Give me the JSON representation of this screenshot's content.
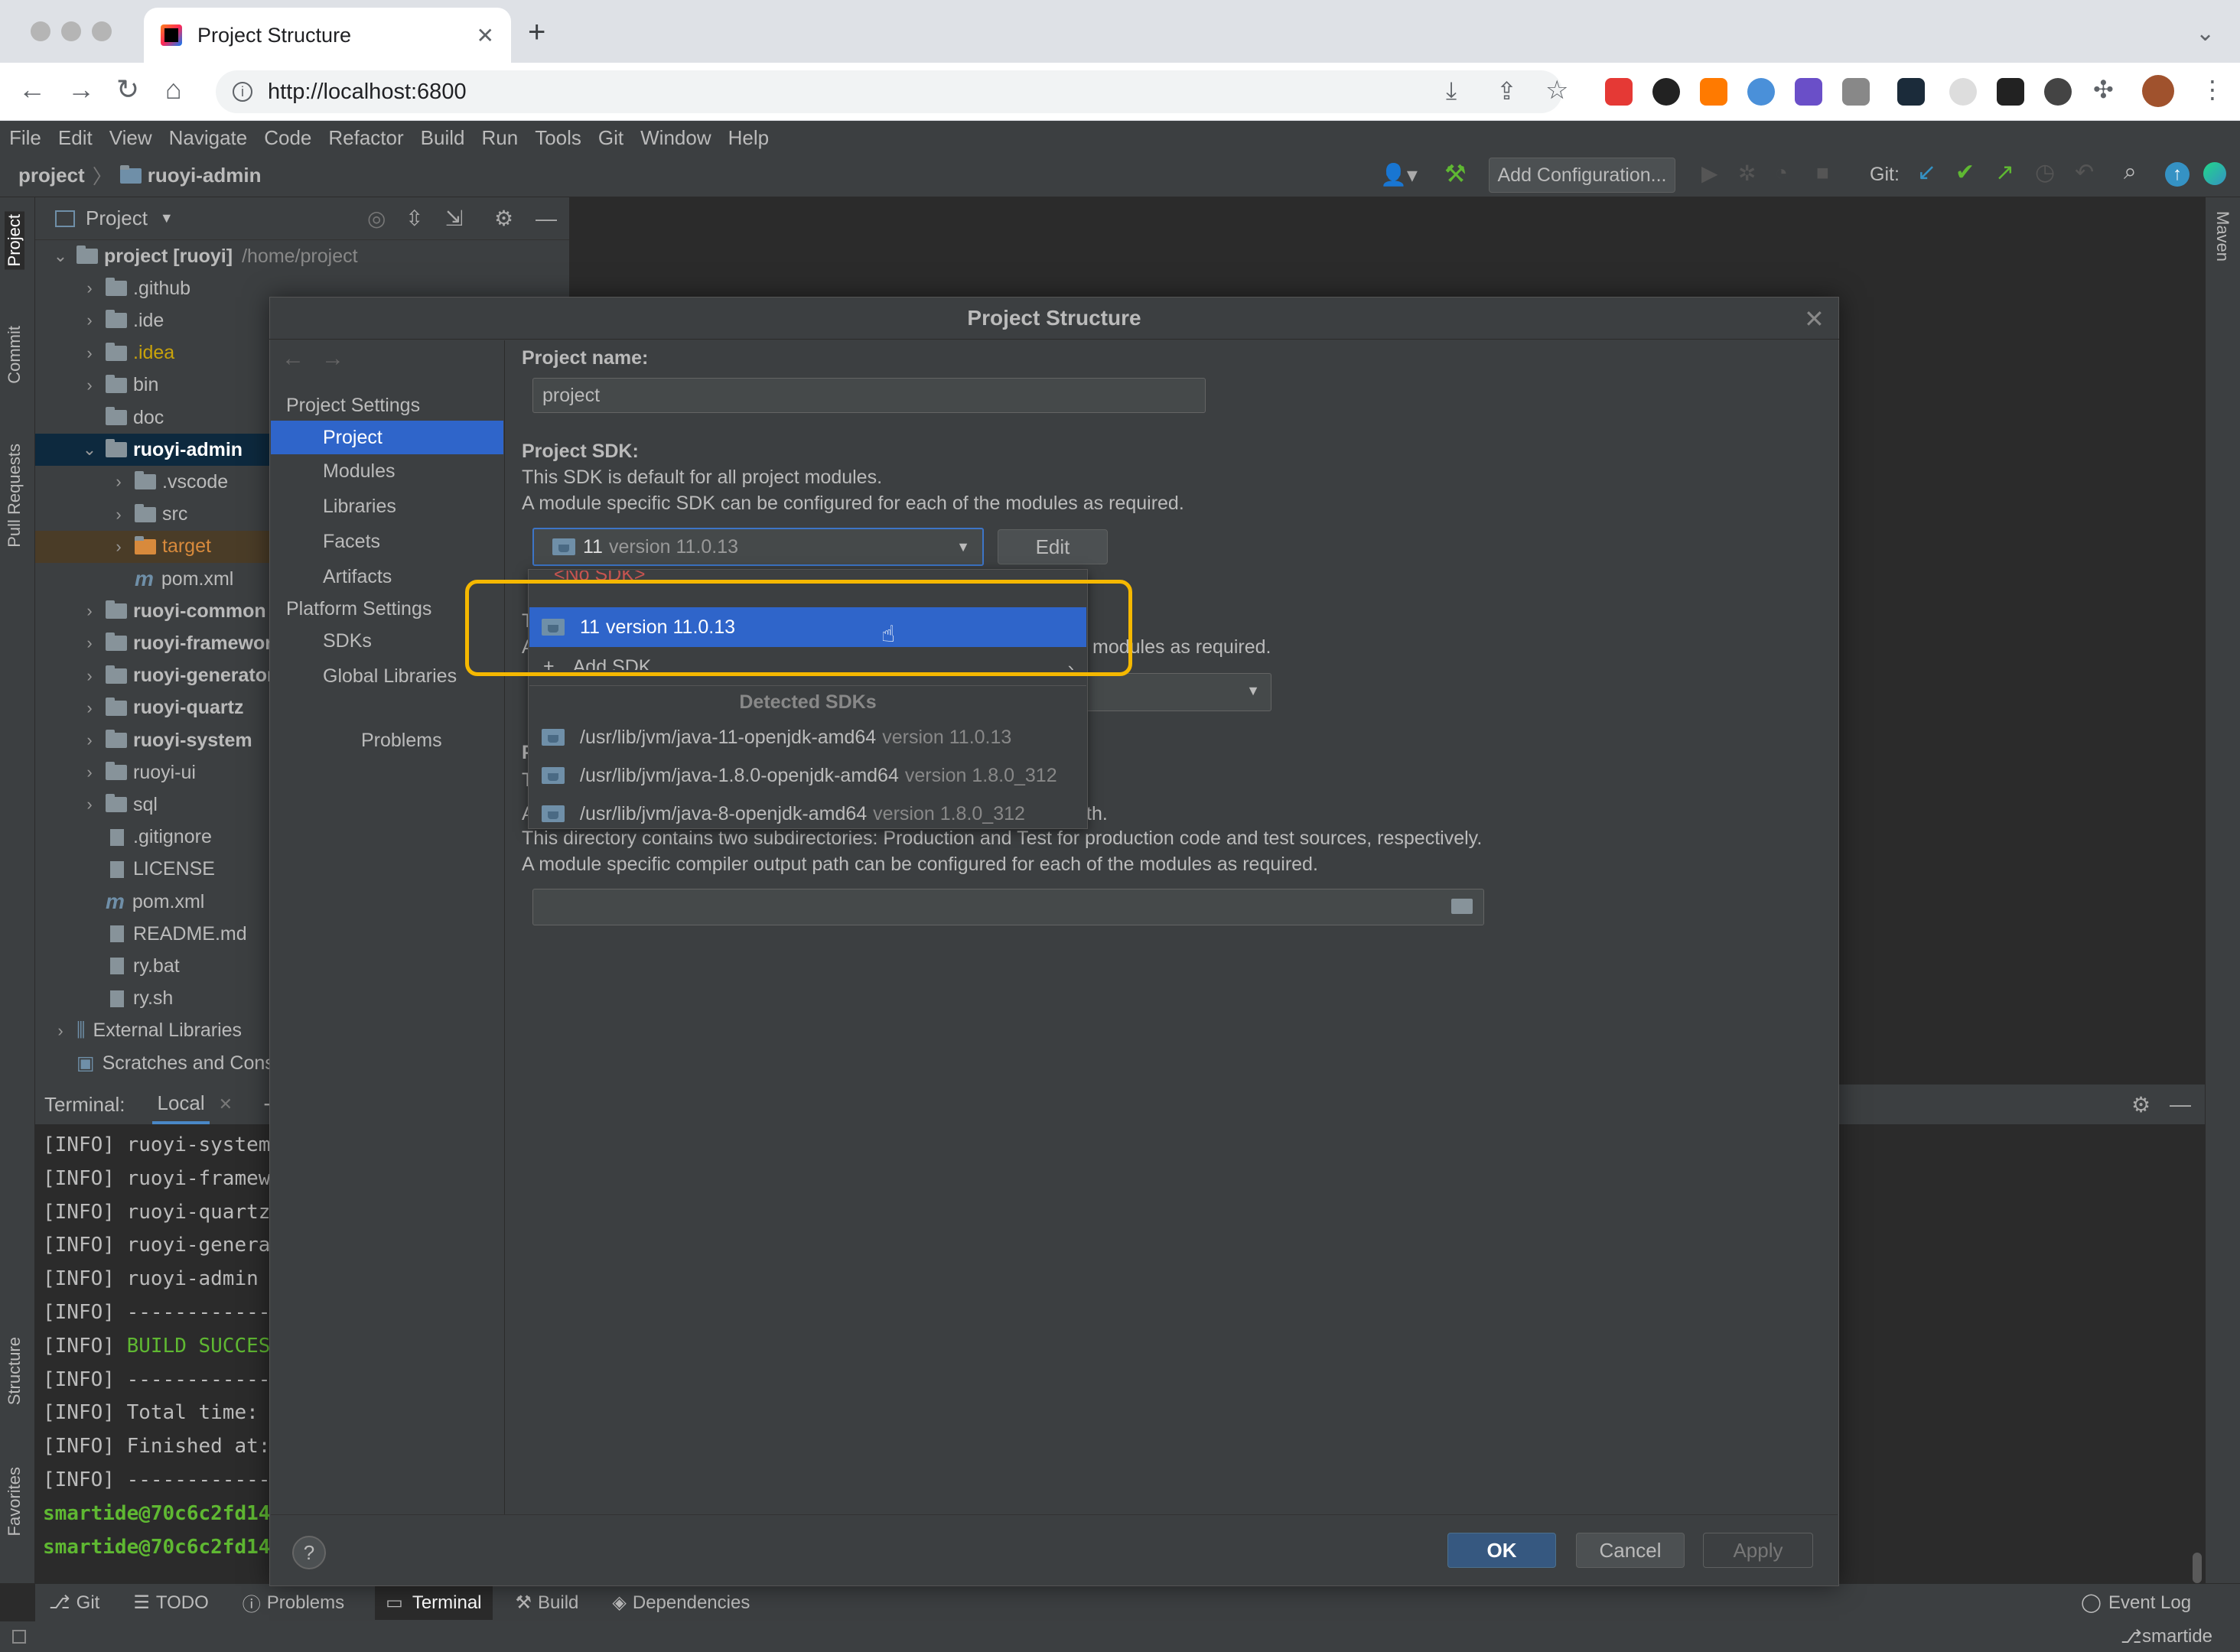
{
  "browser": {
    "tab_title": "Project Structure",
    "new_tab": "+",
    "url": "http://localhost:6800"
  },
  "ide": {
    "menu": [
      "File",
      "Edit",
      "View",
      "Navigate",
      "Code",
      "Refactor",
      "Build",
      "Run",
      "Tools",
      "Git",
      "Window",
      "Help"
    ],
    "breadcrumb": {
      "root": "project",
      "module": "ruoyi-admin"
    },
    "run_config": "Add Configuration...",
    "git_label": "Git:",
    "left_tabs": {
      "project": "Project",
      "commit": "Commit",
      "pull_requests": "Pull Requests",
      "structure": "Structure",
      "favorites": "Favorites"
    },
    "right_tabs": {
      "maven": "Maven"
    },
    "project_panel_title": "Project",
    "tree": [
      {
        "label": "project [ruoyi]",
        "path": "/home/project",
        "indent": 0,
        "chevron": "open",
        "kind": "module",
        "bold": true
      },
      {
        "label": ".github",
        "indent": 1,
        "chevron": "closed",
        "kind": "folder"
      },
      {
        "label": ".ide",
        "indent": 1,
        "chevron": "closed",
        "kind": "folder"
      },
      {
        "label": ".idea",
        "indent": 1,
        "chevron": "closed",
        "kind": "folder",
        "color": "#c9a30b"
      },
      {
        "label": "bin",
        "indent": 1,
        "chevron": "closed",
        "kind": "folder"
      },
      {
        "label": "doc",
        "indent": 1,
        "chevron": "none",
        "kind": "folder"
      },
      {
        "label": "ruoyi-admin",
        "indent": 1,
        "chevron": "open",
        "kind": "module",
        "bold": true,
        "selected": true
      },
      {
        "label": ".vscode",
        "indent": 2,
        "chevron": "closed",
        "kind": "folder"
      },
      {
        "label": "src",
        "indent": 2,
        "chevron": "closed",
        "kind": "folder"
      },
      {
        "label": "target",
        "indent": 2,
        "chevron": "closed",
        "kind": "target",
        "color": "#d88a3c"
      },
      {
        "label": "pom.xml",
        "indent": 2,
        "chevron": "none",
        "kind": "maven"
      },
      {
        "label": "ruoyi-common",
        "indent": 1,
        "chevron": "closed",
        "kind": "module",
        "bold": true
      },
      {
        "label": "ruoyi-framewor",
        "indent": 1,
        "chevron": "closed",
        "kind": "module",
        "bold": true
      },
      {
        "label": "ruoyi-generator",
        "indent": 1,
        "chevron": "closed",
        "kind": "module",
        "bold": true
      },
      {
        "label": "ruoyi-quartz",
        "indent": 1,
        "chevron": "closed",
        "kind": "module",
        "bold": true
      },
      {
        "label": "ruoyi-system",
        "indent": 1,
        "chevron": "closed",
        "kind": "module",
        "bold": true
      },
      {
        "label": "ruoyi-ui",
        "indent": 1,
        "chevron": "closed",
        "kind": "folder"
      },
      {
        "label": "sql",
        "indent": 1,
        "chevron": "closed",
        "kind": "folder"
      },
      {
        "label": ".gitignore",
        "indent": 1,
        "chevron": "none",
        "kind": "file"
      },
      {
        "label": "LICENSE",
        "indent": 1,
        "chevron": "none",
        "kind": "file"
      },
      {
        "label": "pom.xml",
        "indent": 1,
        "chevron": "none",
        "kind": "maven"
      },
      {
        "label": "README.md",
        "indent": 1,
        "chevron": "none",
        "kind": "file"
      },
      {
        "label": "ry.bat",
        "indent": 1,
        "chevron": "none",
        "kind": "file"
      },
      {
        "label": "ry.sh",
        "indent": 1,
        "chevron": "none",
        "kind": "file"
      },
      {
        "label": "External Libraries",
        "indent": 0,
        "chevron": "closed",
        "kind": "libs"
      },
      {
        "label": "Scratches and Cons",
        "indent": 0,
        "chevron": "none",
        "kind": "scratch"
      }
    ],
    "terminal": {
      "label": "Terminal:",
      "tab": "Local",
      "lines": [
        {
          "prefix": "[INFO]",
          "text": " ruoyi-system",
          "color": "#bbbbbb"
        },
        {
          "prefix": "[INFO]",
          "text": " ruoyi-framew",
          "color": "#bbbbbb"
        },
        {
          "prefix": "[INFO]",
          "text": " ruoyi-quartz",
          "color": "#bbbbbb"
        },
        {
          "prefix": "[INFO]",
          "text": " ruoyi-genera",
          "color": "#bbbbbb"
        },
        {
          "prefix": "[INFO]",
          "text": " ruoyi-admin ",
          "color": "#bbbbbb"
        },
        {
          "prefix": "[INFO]",
          "text": " ------------",
          "color": "#bbbbbb"
        },
        {
          "prefix": "[INFO]",
          "text": " BUILD SUCCES",
          "color": "#5fb832"
        },
        {
          "prefix": "[INFO]",
          "text": " ------------",
          "color": "#bbbbbb"
        },
        {
          "prefix": "[INFO]",
          "text": " Total time: ",
          "color": "#bbbbbb"
        },
        {
          "prefix": "[INFO]",
          "text": " Finished at:",
          "color": "#bbbbbb"
        },
        {
          "prefix": "[INFO]",
          "text": " ------------",
          "color": "#bbbbbb"
        },
        {
          "prefix": "",
          "text": "smartide@70c6c2fd14",
          "color": "#5fb832"
        },
        {
          "prefix": "",
          "text": "smartide@70c6c2fd14",
          "color": "#5fb832"
        }
      ]
    },
    "bottom_tabs": [
      "Git",
      "TODO",
      "Problems",
      "Terminal",
      "Build",
      "Dependencies"
    ],
    "event_log": "Event Log",
    "git_branch": "smartide"
  },
  "dialog": {
    "title": "Project Structure",
    "sections": {
      "project_settings": "Project Settings",
      "platform_settings": "Platform Settings"
    },
    "nav": {
      "project": "Project",
      "modules": "Modules",
      "libraries": "Libraries",
      "facets": "Facets",
      "artifacts": "Artifacts",
      "sdks": "SDKs",
      "global_libraries": "Global Libraries",
      "problems": "Problems"
    },
    "project_name_label": "Project name:",
    "project_name_value": "project",
    "sdk_label": "Project SDK:",
    "sdk_desc1": "This SDK is default for all project modules.",
    "sdk_desc2": "A module specific SDK can be configured for each of the modules as required.",
    "sdk_selected_name": "11",
    "sdk_selected_version": "version 11.0.13",
    "edit_button": "Edit",
    "lang_level_partial_1": "T",
    "lang_level_partial_2": "A",
    "lang_level_desc_tail": "modules as required.",
    "compiler_partial_1": "P",
    "compiler_partial_2": "T",
    "compiler_partial_3": "A",
    "compiler_desc1_tail": "th.",
    "compiler_desc2": "This directory contains two subdirectories: Production and Test for production code and test sources, respectively.",
    "compiler_desc3": "A module specific compiler output path can be configured for each of the modules as required.",
    "popup": {
      "no_sdk": "<No SDK>",
      "selected_name": "11",
      "selected_version": "version 11.0.13",
      "add_sdk": "Add SDK",
      "detected_header": "Detected SDKs",
      "detected": [
        {
          "path": "/usr/lib/jvm/java-11-openjdk-amd64",
          "version": "version 11.0.13"
        },
        {
          "path": "/usr/lib/jvm/java-1.8.0-openjdk-amd64",
          "version": "version 1.8.0_312"
        },
        {
          "path": "/usr/lib/jvm/java-8-openjdk-amd64",
          "version": "version 1.8.0_312"
        }
      ]
    },
    "ok": "OK",
    "cancel": "Cancel",
    "apply": "Apply",
    "help": "?"
  },
  "colors": {
    "selection": "#2f65ca",
    "highlight_box": "#f5b800",
    "ok_button": "#365880",
    "tree_selected": "#0d293e"
  }
}
